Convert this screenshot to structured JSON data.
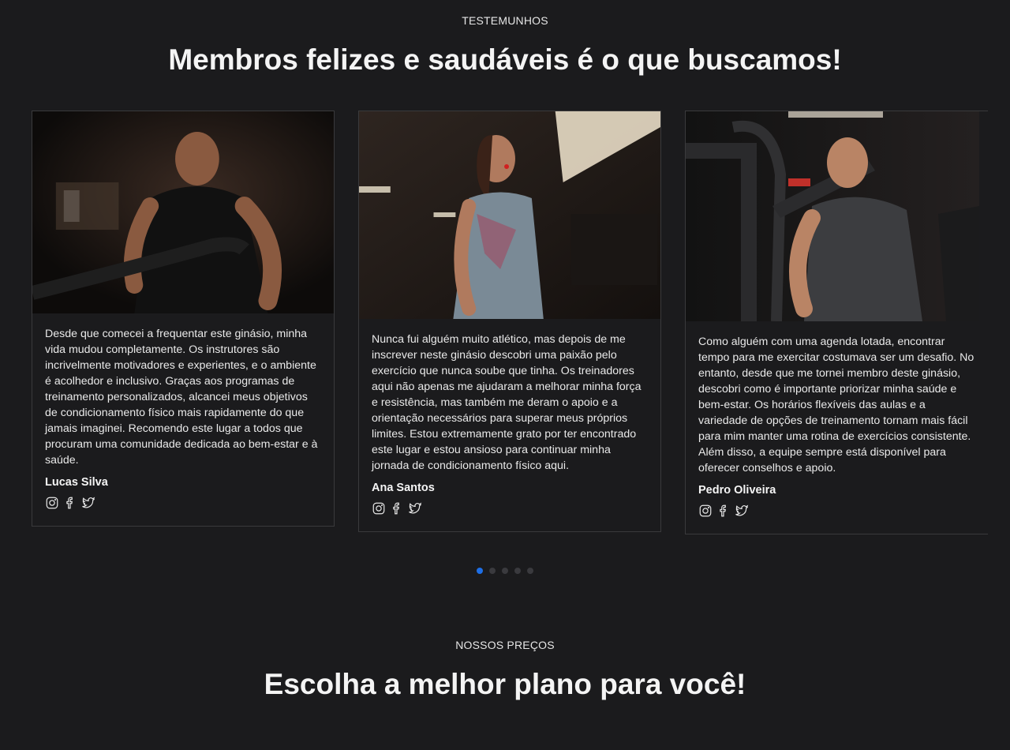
{
  "testimonials": {
    "eyebrow": "TESTEMUNHOS",
    "title": "Membros felizes e saudáveis é o que buscamos!",
    "cards": [
      {
        "text": "Desde que comecei a frequentar este ginásio, minha vida mudou completamente. Os instrutores são incrivelmente motivadores e experientes, e o ambiente é acolhedor e inclusivo. Graças aos programas de treinamento personalizados, alcancei meus objetivos de condicionamento físico mais rapidamente do que jamais imaginei. Recomendo este lugar a todos que procuram uma comunidade dedicada ao bem-estar e à saúde.",
        "name": "Lucas Silva"
      },
      {
        "text": "Nunca fui alguém muito atlético, mas depois de me inscrever neste ginásio descobri uma paixão pelo exercício que nunca soube que tinha. Os treinadores aqui não apenas me ajudaram a melhorar minha força e resistência, mas também me deram o apoio e a orientação necessários para superar meus próprios limites. Estou extremamente grato por ter encontrado este lugar e estou ansioso para continuar minha jornada de condicionamento físico aqui.",
        "name": "Ana Santos"
      },
      {
        "text": "Como alguém com uma agenda lotada, encontrar tempo para me exercitar costumava ser um desafio. No entanto, desde que me tornei membro deste ginásio, descobri como é importante priorizar minha saúde e bem-estar. Os horários flexíveis das aulas e a variedade de opções de treinamento tornam mais fácil para mim manter uma rotina de exercícios consistente. Além disso, a equipe sempre está disponível para oferecer conselhos e apoio.",
        "name": "Pedro Oliveira"
      }
    ],
    "social_icons": [
      "instagram-icon",
      "facebook-icon",
      "twitter-icon"
    ],
    "carousel": {
      "total_slides": 5,
      "active_slide": 1
    }
  },
  "pricing": {
    "eyebrow": "NOSSOS PREÇOS",
    "title": "Escolha a melhor plano para você!"
  },
  "colors": {
    "background": "#1b1b1d",
    "accent": "#1e6fe6",
    "card_border": "#3a3a3c"
  }
}
